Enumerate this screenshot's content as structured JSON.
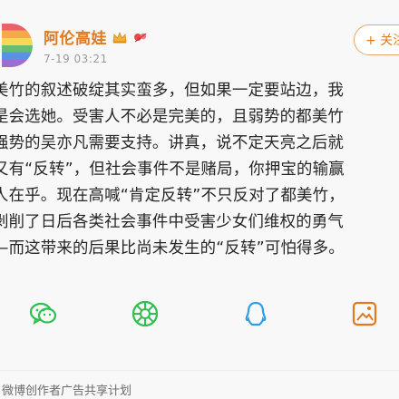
{
  "post": {
    "author": "阿伦高娃",
    "time": "7-19 03:21",
    "follow_label": "+ 关注",
    "lines": [
      "美竹的叙述破绽其实蛮多，但如果一定要站边，我",
      "是会选她。受害人不必是完美的，且弱势的都美竹",
      "强势的吴亦凡需要支持。讲真，说不定天亮之后就",
      "又有“反转”，但社会事件不是赌局，你押宝的输赢",
      "人在乎。现在高喊“肯定反转”不只反对了都美竹，",
      "剥削了日后各类社会事件中受害少女们维权的勇气",
      "—而这带来的后果比尚未发生的“反转”可怕得多。"
    ]
  },
  "share": {
    "icons": [
      "wechat-icon",
      "moments-icon",
      "qq-icon",
      "save-image-icon"
    ]
  },
  "footer": {
    "text": "微博创作者广告共享计划"
  },
  "colors": {
    "accent": "#e07a1f",
    "wechat": "#2fbf4f",
    "qq": "#2e9fe6"
  }
}
